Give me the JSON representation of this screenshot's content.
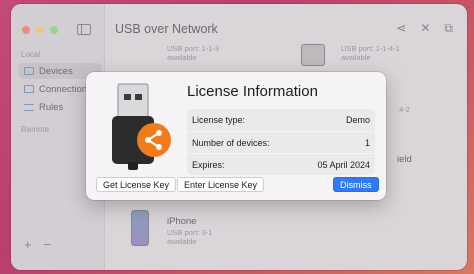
{
  "window": {
    "title": "USB over Network",
    "sidebar": {
      "section_local": "Local",
      "section_remote": "Remote",
      "items": [
        {
          "label": "Devices"
        },
        {
          "label": "Connections"
        },
        {
          "label": "Rules"
        }
      ],
      "bottom_add": "+",
      "bottom_remove": "−"
    },
    "toolbar": {
      "share_icon": "share-icon",
      "disconnect_icon": "disconnect-icon",
      "remote_icon": "remote-desktop-icon"
    },
    "background_devices": [
      {
        "subtext": "USB port: 1-1-3",
        "subtext2": "available"
      },
      {
        "subtext": "USB port: 1-1-4-1",
        "subtext2": "available"
      },
      {
        "subtext": "4-2"
      },
      {
        "subtext": "ield"
      },
      {
        "name": "iPhone",
        "subtext": "USB port: 3-1",
        "subtext2": "available"
      }
    ]
  },
  "dialog": {
    "title": "License Information",
    "rows": [
      {
        "label": "License type:",
        "value": "Demo"
      },
      {
        "label": "Number of devices:",
        "value": "1"
      },
      {
        "label": "Expires:",
        "value": "05 April 2024"
      }
    ],
    "buttons": {
      "get_license": "Get License Key",
      "enter_license": "Enter License Key",
      "dismiss": "Dismiss"
    },
    "colors": {
      "accent": "#2f7bf5",
      "share_badge": "#f07c1c"
    }
  }
}
